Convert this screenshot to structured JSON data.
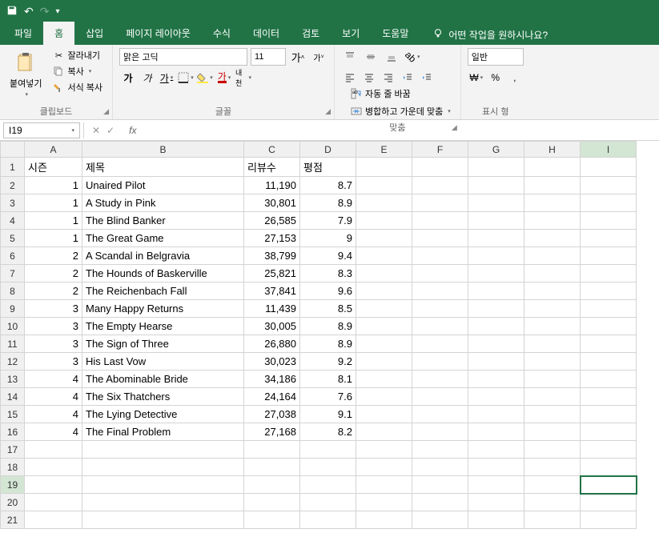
{
  "titlebar": {
    "save_icon": "💾",
    "undo_icon": "↶",
    "redo_icon": "↷"
  },
  "tabs": {
    "file": "파일",
    "home": "홈",
    "insert": "삽입",
    "page_layout": "페이지 레이아웃",
    "formulas": "수식",
    "data": "데이터",
    "review": "검토",
    "view": "보기",
    "help": "도움말",
    "tell_me": "어떤 작업을 원하시나요?"
  },
  "ribbon": {
    "clipboard": {
      "paste": "붙여넣기",
      "cut": "잘라내기",
      "copy": "복사",
      "copy_dd": "▾",
      "format_painter": "서식 복사",
      "label": "클립보드"
    },
    "font": {
      "name": "맑은 고딕",
      "size": "11",
      "bold": "가",
      "italic": "가",
      "underline": "가",
      "font_color_label": "가",
      "hanja": "내천",
      "label": "글꼴"
    },
    "alignment": {
      "wrap": "자동 줄 바꿈",
      "merge": "병합하고 가운데 맞춤",
      "label": "맞춤"
    },
    "number": {
      "general": "일반",
      "percent": "%",
      "comma": ",",
      "label": "표시 형"
    }
  },
  "namebox": "I19",
  "formula": "",
  "columns": [
    "A",
    "B",
    "C",
    "D",
    "E",
    "F",
    "G",
    "H",
    "I"
  ],
  "headers": {
    "season": "시즌",
    "title": "제목",
    "reviews": "리뷰수",
    "rating": "평점"
  },
  "rows": [
    {
      "s": "1",
      "t": "Unaired Pilot",
      "r": "11,190",
      "p": "8.7"
    },
    {
      "s": "1",
      "t": "A Study in Pink",
      "r": "30,801",
      "p": "8.9"
    },
    {
      "s": "1",
      "t": "The Blind Banker",
      "r": "26,585",
      "p": "7.9"
    },
    {
      "s": "1",
      "t": "The Great Game",
      "r": "27,153",
      "p": "9"
    },
    {
      "s": "2",
      "t": "A Scandal in Belgravia",
      "r": "38,799",
      "p": "9.4"
    },
    {
      "s": "2",
      "t": "The Hounds of Baskerville",
      "r": "25,821",
      "p": "8.3"
    },
    {
      "s": "2",
      "t": "The Reichenbach Fall",
      "r": "37,841",
      "p": "9.6"
    },
    {
      "s": "3",
      "t": "Many Happy Returns",
      "r": "11,439",
      "p": "8.5"
    },
    {
      "s": "3",
      "t": "The Empty Hearse",
      "r": "30,005",
      "p": "8.9"
    },
    {
      "s": "3",
      "t": "The Sign of Three",
      "r": "26,880",
      "p": "8.9"
    },
    {
      "s": "3",
      "t": "His Last Vow",
      "r": "30,023",
      "p": "9.2"
    },
    {
      "s": "4",
      "t": "The Abominable Bride",
      "r": "34,186",
      "p": "8.1"
    },
    {
      "s": "4",
      "t": "The Six Thatchers",
      "r": "24,164",
      "p": "7.6"
    },
    {
      "s": "4",
      "t": "The Lying Detective",
      "r": "27,038",
      "p": "9.1"
    },
    {
      "s": "4",
      "t": "The Final Problem",
      "r": "27,168",
      "p": "8.2"
    }
  ],
  "selected_cell": "I19",
  "currency_icon": "₩"
}
